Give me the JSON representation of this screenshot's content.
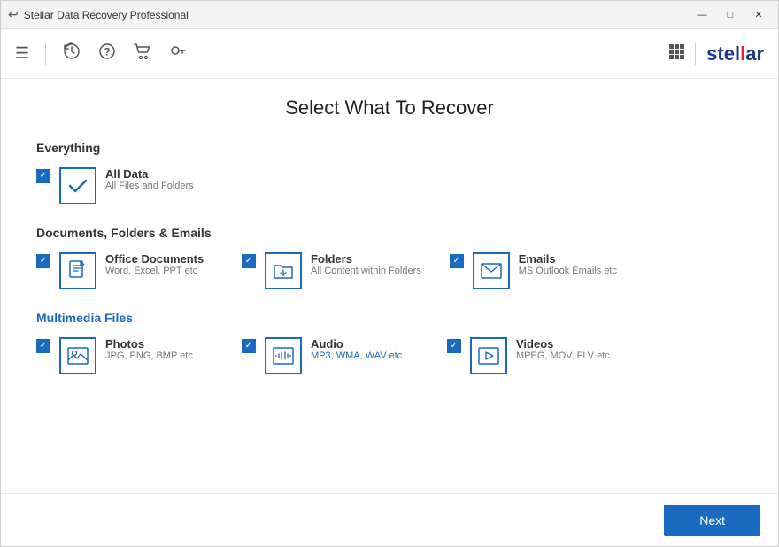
{
  "titleBar": {
    "title": "Stellar Data Recovery Professional",
    "minimize": "—",
    "maximize": "□",
    "close": "✕"
  },
  "toolbar": {
    "icons": [
      "hamburger",
      "history",
      "help",
      "cart",
      "key"
    ],
    "brand": "stel",
    "brandRed": "l",
    "brandEnd": "ar"
  },
  "page": {
    "title": "Select What To Recover"
  },
  "sections": [
    {
      "id": "everything",
      "title": "Everything",
      "titleColor": "normal",
      "items": [
        {
          "id": "all-data",
          "label": "All Data",
          "sublabel": "All Files and Folders",
          "sublabelColor": "normal",
          "checked": true,
          "iconType": "checkmark"
        }
      ]
    },
    {
      "id": "documents",
      "title": "Documents, Folders & Emails",
      "titleColor": "normal",
      "items": [
        {
          "id": "office-docs",
          "label": "Office Documents",
          "sublabel": "Word, Excel, PPT etc",
          "sublabelColor": "normal",
          "checked": true,
          "iconType": "document"
        },
        {
          "id": "folders",
          "label": "Folders",
          "sublabel": "All Content within Folders",
          "sublabelColor": "normal",
          "checked": true,
          "iconType": "folder"
        },
        {
          "id": "emails",
          "label": "Emails",
          "sublabel": "MS Outlook Emails etc",
          "sublabelColor": "normal",
          "checked": true,
          "iconType": "email"
        }
      ]
    },
    {
      "id": "multimedia",
      "title": "Multimedia Files",
      "titleColor": "blue",
      "items": [
        {
          "id": "photos",
          "label": "Photos",
          "sublabel": "JPG, PNG, BMP etc",
          "sublabelColor": "normal",
          "checked": true,
          "iconType": "photo"
        },
        {
          "id": "audio",
          "label": "Audio",
          "sublabel": "MP3, WMA, WAV etc",
          "sublabelColor": "blue",
          "checked": true,
          "iconType": "audio"
        },
        {
          "id": "videos",
          "label": "Videos",
          "sublabel": "MPEG, MOV, FLV etc",
          "sublabelColor": "normal",
          "checked": true,
          "iconType": "video"
        }
      ]
    }
  ],
  "footer": {
    "nextLabel": "Next"
  }
}
